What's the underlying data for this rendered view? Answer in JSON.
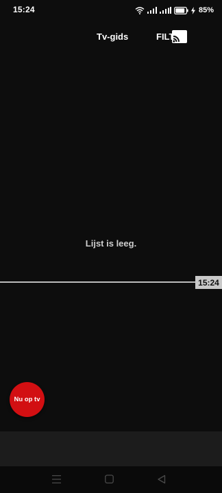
{
  "status_bar": {
    "time": "15:24",
    "battery_percent": "85%",
    "icons": [
      "wifi-icon",
      "signal-icon",
      "signal-icon",
      "battery-icon",
      "charging-icon"
    ]
  },
  "header": {
    "tab_guide_label": "Tv-gids",
    "tab_filter_label": "FILT",
    "cast_icon": "cast-icon"
  },
  "main": {
    "empty_message": "Lijst is leeg.",
    "now_marker_time": "15:24"
  },
  "fab": {
    "label": "Nu op tv",
    "color": "#d20f12"
  },
  "nav_bar": {
    "buttons": [
      "menu-icon",
      "home-icon",
      "back-icon"
    ]
  }
}
